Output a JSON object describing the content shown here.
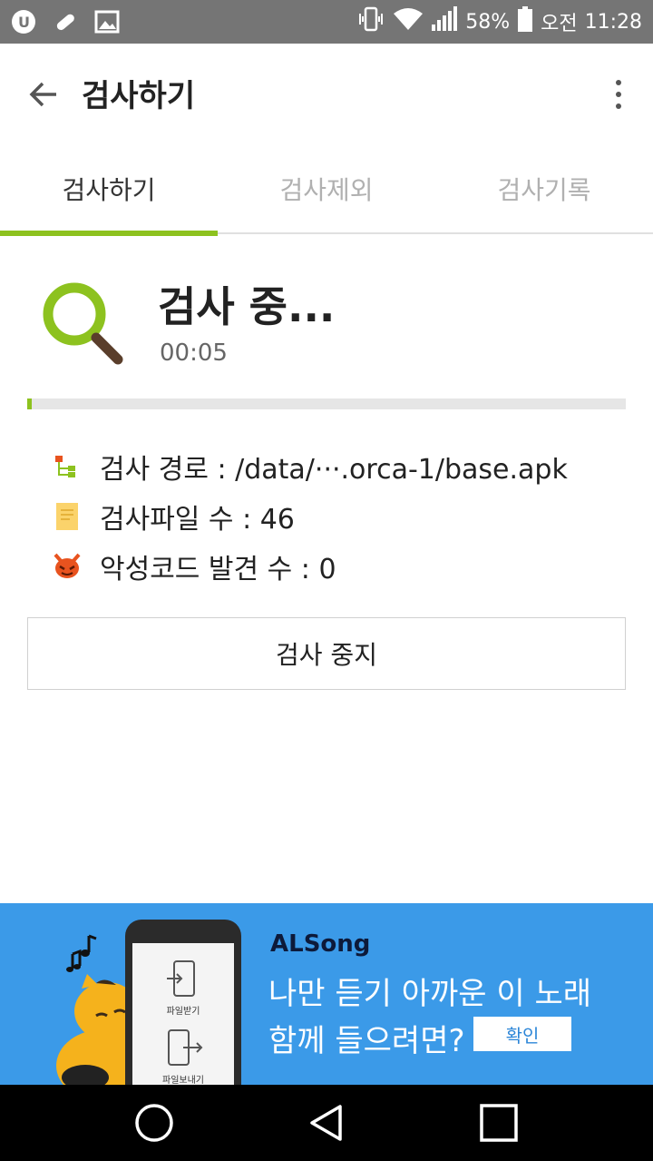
{
  "status_bar": {
    "battery": "58%",
    "ampm": "오전",
    "time": "11:28",
    "icons": [
      "uplus-icon",
      "pill-icon",
      "image-icon",
      "vibrate-icon",
      "wifi-icon",
      "signal-icon",
      "battery-icon"
    ]
  },
  "app_bar": {
    "title": "검사하기",
    "back_icon": "arrow-left-icon",
    "more_icon": "more-vert-icon"
  },
  "tabs": [
    {
      "label": "검사하기",
      "active": true
    },
    {
      "label": "검사제외",
      "active": false
    },
    {
      "label": "검사기록",
      "active": false
    }
  ],
  "scan": {
    "status": "검사 중...",
    "elapsed": "00:05",
    "progress": 0.008,
    "path_label": "검사 경로 : /data/···.orca-1/base.apk",
    "files_label": "검사파일 수 : 46",
    "malware_label": "악성코드 발견 수 : 0",
    "stop_label": "검사 중지"
  },
  "ad": {
    "brand": "ALSong",
    "line1": "나만 듣기 아까운 이 노래",
    "line2": "함께 들으려면?",
    "button": "확인",
    "phone_label_receive": "파일받기",
    "phone_label_send": "파일보내기"
  },
  "colors": {
    "accent": "#8dc21f",
    "status_bar": "#757575",
    "ad_bg": "#3b9ae8",
    "malware_icon": "#e8531f"
  }
}
